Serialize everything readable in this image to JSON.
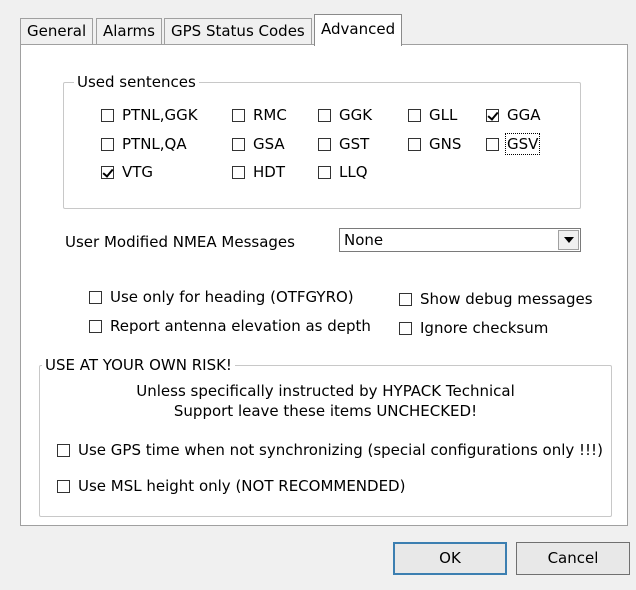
{
  "tabs": [
    {
      "label": "General"
    },
    {
      "label": "Alarms"
    },
    {
      "label": "GPS Status Codes"
    },
    {
      "label": "Advanced"
    }
  ],
  "used_sentences": {
    "title": "Used sentences",
    "items": [
      {
        "label": "PTNL,GGK",
        "checked": false
      },
      {
        "label": "RMC",
        "checked": false
      },
      {
        "label": "GGK",
        "checked": false
      },
      {
        "label": "GLL",
        "checked": false
      },
      {
        "label": "GGA",
        "checked": true
      },
      {
        "label": "PTNL,QA",
        "checked": false
      },
      {
        "label": "GSA",
        "checked": false
      },
      {
        "label": "GST",
        "checked": false
      },
      {
        "label": "GNS",
        "checked": false
      },
      {
        "label": "GSV",
        "checked": false
      },
      {
        "label": "VTG",
        "checked": true
      },
      {
        "label": "HDT",
        "checked": false
      },
      {
        "label": "LLQ",
        "checked": false
      }
    ]
  },
  "nmea": {
    "label": "User Modified NMEA Messages",
    "selected": "None"
  },
  "options": {
    "heading_only": {
      "label": "Use only for heading (OTFGYRO)",
      "checked": false
    },
    "show_debug": {
      "label": "Show debug messages",
      "checked": false
    },
    "antenna_depth": {
      "label": "Report antenna elevation as depth",
      "checked": false
    },
    "ignore_checksum": {
      "label": "Ignore checksum",
      "checked": false
    }
  },
  "risk": {
    "title": "USE AT YOUR OWN RISK!",
    "warning_line1": "Unless specifically instructed by HYPACK Technical",
    "warning_line2": "Support leave these items UNCHECKED!",
    "gps_time": {
      "label": "Use GPS time when not synchronizing (special configurations only !!!)",
      "checked": false
    },
    "msl_height": {
      "label": "Use MSL height only (NOT RECOMMENDED)",
      "checked": false
    }
  },
  "buttons": {
    "ok": "OK",
    "cancel": "Cancel"
  }
}
